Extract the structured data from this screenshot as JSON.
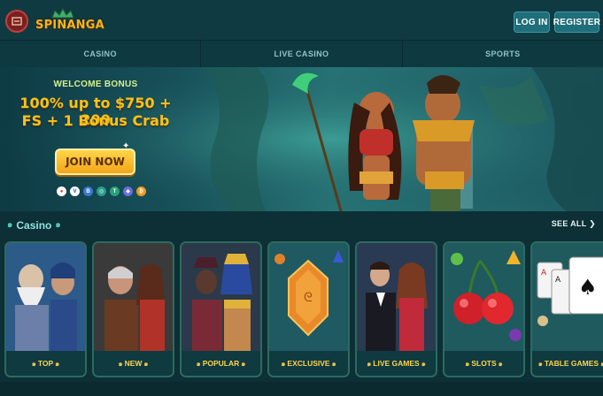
{
  "header": {
    "logo_text": "SPINANGA",
    "login_label": "LOG IN",
    "register_label": "REGISTER"
  },
  "nav": {
    "items": [
      {
        "label": "CASINO"
      },
      {
        "label": "LIVE CASINO"
      },
      {
        "label": "SPORTS"
      }
    ]
  },
  "banner": {
    "welcome": "WELCOME BONUS",
    "bonus_line_1": "100% up to $750 + 200",
    "bonus_line_2": "FS + 1 Bonus Crab",
    "join_label": "JOIN NOW",
    "payment_icons": [
      {
        "name": "mastercard-icon",
        "color": "#e2352a",
        "glyph": "●"
      },
      {
        "name": "visa-icon",
        "color": "#1a4bbd",
        "glyph": "V"
      },
      {
        "name": "bank-icon",
        "color": "#3b78d6",
        "glyph": "B"
      },
      {
        "name": "crypto-icon",
        "color": "#2b9c8c",
        "glyph": "◎"
      },
      {
        "name": "tether-icon",
        "color": "#27a17a",
        "glyph": "T"
      },
      {
        "name": "ethereum-icon",
        "color": "#6a6ee0",
        "glyph": "◆"
      },
      {
        "name": "bitcoin-icon",
        "color": "#f29a1a",
        "glyph": "₿"
      }
    ]
  },
  "section": {
    "title": "Casino",
    "see_all": "SEE ALL"
  },
  "cards": [
    {
      "label": "TOP",
      "accent": "#3b6fb6"
    },
    {
      "label": "NEW",
      "accent": "#7a3a2a"
    },
    {
      "label": "POPULAR",
      "accent": "#b3632a"
    },
    {
      "label": "EXCLUSIVE",
      "accent": "#d9842a"
    },
    {
      "label": "LIVE GAMES",
      "accent": "#3f5f7a"
    },
    {
      "label": "SLOTS",
      "accent": "#c8202a"
    },
    {
      "label": "TABLE GAMES",
      "accent": "#e9e9e9"
    }
  ]
}
